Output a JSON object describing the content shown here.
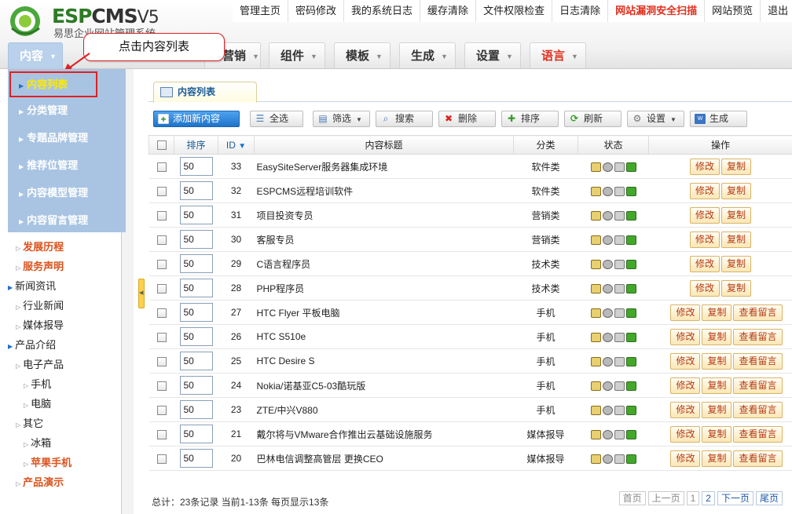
{
  "logo": {
    "brand_a": "ESP",
    "brand_b": "CMS",
    "brand_v": "V5",
    "subtitle": "易思企业网站管理系统"
  },
  "topnav": [
    "管理主页",
    "密码修改",
    "我的系统日志",
    "缓存清除",
    "文件权限检查",
    "日志清除",
    "网站漏洞安全扫描",
    "网站预览",
    "退出"
  ],
  "mainmenu": {
    "content": "内容",
    "marketing": "营销",
    "components": "组件",
    "template": "模板",
    "generate": "生成",
    "settings": "设置",
    "language": "语言"
  },
  "callout": "点击内容列表",
  "dropdown": [
    "内容列表",
    "分类管理",
    "专题品牌管理",
    "推荐位管理",
    "内容模型管理",
    "内容留言管理"
  ],
  "tree": [
    "发展历程",
    "服务声明",
    "新闻资讯",
    "行业新闻",
    "媒体报导",
    "产品介绍",
    "电子产品",
    "手机",
    "电脑",
    "其它",
    "冰箱",
    "苹果手机",
    "产品演示"
  ],
  "tab": "内容列表",
  "toolbar": {
    "add": "添加新内容",
    "select_all": "全选",
    "filter": "筛选",
    "search": "搜索",
    "delete": "删除",
    "sort": "排序",
    "refresh": "刷新",
    "settings": "设置",
    "generate": "生成"
  },
  "columns": {
    "sort": "排序",
    "id": "ID",
    "title": "内容标题",
    "category": "分类",
    "status": "状态",
    "actions": "操作"
  },
  "action_labels": {
    "edit": "修改",
    "copy": "复制",
    "view_msgs": "查看留言"
  },
  "rows": [
    {
      "sort": "50",
      "id": "33",
      "title": "EasySiteServer服务器集成环境",
      "cat": "软件类",
      "msgs": false
    },
    {
      "sort": "50",
      "id": "32",
      "title": "ESPCMS远程培训软件",
      "cat": "软件类",
      "msgs": false
    },
    {
      "sort": "50",
      "id": "31",
      "title": "项目投资专员",
      "cat": "营销类",
      "msgs": false
    },
    {
      "sort": "50",
      "id": "30",
      "title": "客服专员",
      "cat": "营销类",
      "msgs": false
    },
    {
      "sort": "50",
      "id": "29",
      "title": "C语言程序员",
      "cat": "技术类",
      "msgs": false
    },
    {
      "sort": "50",
      "id": "28",
      "title": "PHP程序员",
      "cat": "技术类",
      "msgs": false
    },
    {
      "sort": "50",
      "id": "27",
      "title": "HTC Flyer 平板电脑",
      "cat": "手机",
      "msgs": true
    },
    {
      "sort": "50",
      "id": "26",
      "title": "HTC S510e",
      "cat": "手机",
      "msgs": true
    },
    {
      "sort": "50",
      "id": "25",
      "title": "HTC Desire S",
      "cat": "手机",
      "msgs": true
    },
    {
      "sort": "50",
      "id": "24",
      "title": "Nokia/诺基亚C5-03酷玩版",
      "cat": "手机",
      "msgs": true
    },
    {
      "sort": "50",
      "id": "23",
      "title": "ZTE/中兴V880",
      "cat": "手机",
      "msgs": true
    },
    {
      "sort": "50",
      "id": "21",
      "title": "戴尔将与VMware合作推出云基础设施服务",
      "cat": "媒体报导",
      "msgs": true
    },
    {
      "sort": "50",
      "id": "20",
      "title": "巴林电信调整高管层 更换CEO",
      "cat": "媒体报导",
      "msgs": true
    }
  ],
  "footer": "总计：23条记录 当前1-13条 每页显示13条",
  "pager": {
    "first": "首页",
    "prev": "上一页",
    "p1": "1",
    "p2": "2",
    "next": "下一页",
    "last": "尾页"
  },
  "colors": {
    "accent": "#1e73c9",
    "menu_blue": "#a9c4e2",
    "highlight_red": "#e02020",
    "hot_text": "#e0301e"
  }
}
